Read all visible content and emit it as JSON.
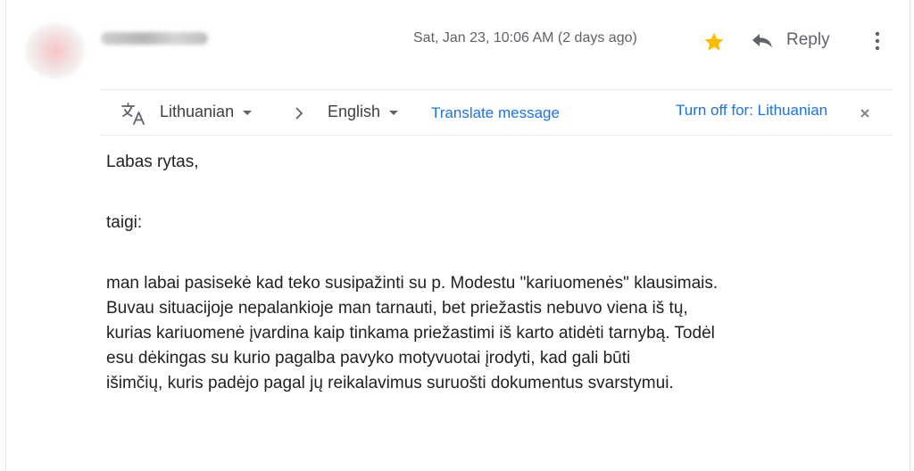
{
  "header": {
    "date": "Sat, Jan 23, 10:06 AM (2 days ago)",
    "star_icon": "star-icon",
    "star_color": "#fbbc04",
    "reply_label": "Reply",
    "reply_icon": "reply-icon",
    "more_icon": "more-vert-icon"
  },
  "translate_bar": {
    "icon": "translate-icon",
    "source_language": "Lithuanian",
    "target_language": "English",
    "translate_link": "Translate message",
    "turn_off_link": "Turn off for: Lithuanian",
    "link_color": "#1a73e8"
  },
  "message": {
    "greeting": "Labas rytas,",
    "line2": "taigi:",
    "paragraph": [
      "man labai pasisekė kad teko susipažinti su p. Modestu \"kariuomenės\" klausimais.",
      "Buvau situacijoje nepalankioje man tarnauti, bet priežastis nebuvo viena iš tų,",
      "kurias kariuomenė įvardina kaip tinkama priežastimi iš karto atidėti tarnybą. Todėl",
      "esu dėkingas  su kurio pagalba pavyko motyvuotai įrodyti, kad gali būti",
      "išimčių, kuris padėjo pagal jų reikalavimus suruošti dokumentus svarstymui."
    ]
  }
}
